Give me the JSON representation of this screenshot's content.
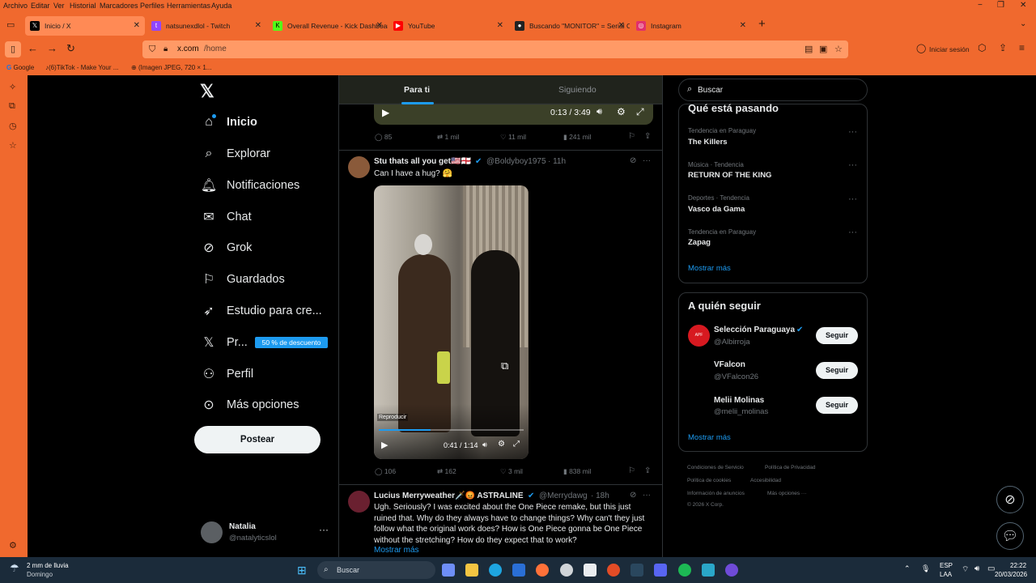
{
  "menubar": {
    "items": [
      "Archivo",
      "Editar",
      "Ver",
      "Historial",
      "Marcadores",
      "Perfiles",
      "Herramientas",
      "Ayuda"
    ]
  },
  "tabs": [
    {
      "label": "Inicio / X",
      "icon": "x-logo-icon",
      "color": "#000000",
      "active": true
    },
    {
      "label": "natsunexdlol - Twitch",
      "icon": "twitch-icon",
      "color": "#9146ff"
    },
    {
      "label": "Overall Revenue - Kick Dashboard",
      "icon": "kick-icon",
      "color": "#53fc18"
    },
    {
      "label": "YouTube",
      "icon": "youtube-icon",
      "color": "#ff0000"
    },
    {
      "label": "Buscando \"MONITOR\" = Serial C",
      "icon": "serial-icon",
      "color": "#222222"
    },
    {
      "label": "Instagram",
      "icon": "instagram-icon",
      "color": "#e1306c"
    }
  ],
  "url": {
    "domain": "x.com",
    "path": "/home"
  },
  "signin": "Iniciar sesión",
  "bookmarks": [
    "Google",
    "(6)TikTok - Make Your ...",
    "(Imagen JPEG, 720 × 1..."
  ],
  "leftnav": {
    "items": [
      {
        "label": "Inicio",
        "icon": "home-icon"
      },
      {
        "label": "Explorar",
        "icon": "search-icon"
      },
      {
        "label": "Notificaciones",
        "icon": "bell-icon"
      },
      {
        "label": "Chat",
        "icon": "mail-icon"
      },
      {
        "label": "Grok",
        "icon": "grok-icon"
      },
      {
        "label": "Guardados",
        "icon": "bookmark-icon"
      },
      {
        "label": "Estudio para cre...",
        "icon": "rocket-icon"
      },
      {
        "label": "Pr...",
        "icon": "x-premium-icon"
      },
      {
        "label": "Perfil",
        "icon": "person-icon"
      },
      {
        "label": "Más opciones",
        "icon": "more-circle-icon"
      }
    ],
    "promo": "50 % de descuento",
    "post": "Postear",
    "user": {
      "name": "Natalia",
      "handle": "@natalyticslol"
    }
  },
  "feed": {
    "tabs": [
      "Para ti",
      "Siguiendo"
    ],
    "top_video": {
      "time": "0:13 / 3:49"
    },
    "top_actions": {
      "replies": "85",
      "reposts": "1 mil",
      "likes": "11 mil",
      "views": "241 mil"
    },
    "tweet1": {
      "name": "Stu thats all you get🇺🇸🏴󠁧󠁢󠁥󠁮󠁧󠁿",
      "handle": "@Boldyboy1975",
      "time": "· 11h",
      "text": "Can I have a hug? 🤗",
      "video": {
        "label": "Reproducir",
        "time": "0:41 / 1:14"
      },
      "actions": {
        "replies": "106",
        "reposts": "162",
        "likes": "3 mil",
        "views": "838 mil"
      }
    },
    "tweet2": {
      "name": "Lucius Merryweather🗡️😡 ASTRALINE",
      "handle": "@Merrydawg",
      "time": "· 18h",
      "text": "Ugh. Seriously? I was excited about the One Piece remake, but this just ruined that. Why do they always have to change things? Why can't they just follow what the original work does? How is One Piece gonna be One Piece without the stretching? How do they expect that to work?",
      "more": "Mostrar más"
    }
  },
  "right": {
    "search_placeholder": "Buscar",
    "trends_title": "Qué está pasando",
    "trends": [
      {
        "sub": "Tendencia en Paraguay",
        "name": "The Killers"
      },
      {
        "sub": "Música · Tendencia",
        "name": "RETURN OF THE KING"
      },
      {
        "sub": "Deportes · Tendencia",
        "name": "Vasco da Gama"
      },
      {
        "sub": "Tendencia en Paraguay",
        "name": "Zapag"
      }
    ],
    "show_more": "Mostrar más",
    "follow_title": "A quién seguir",
    "follow": [
      {
        "name": "Selección Paraguaya",
        "handle": "@Albirroja",
        "verified": true
      },
      {
        "name": "VFalcon",
        "handle": "@VFalcon26"
      },
      {
        "name": "Melii Molinas",
        "handle": "@melii_molinas"
      }
    ],
    "follow_btn": "Seguir",
    "footer": [
      "Condiciones de Servicio",
      "Política de Privacidad",
      "Política de cookies",
      "Accesibilidad",
      "Información de anuncios",
      "Más opciones ···",
      "© 2026 X Corp."
    ]
  },
  "taskbar": {
    "weather": "2 mm de lluvia",
    "weather_sub": "Domingo",
    "search": "Buscar",
    "lang": "ESP",
    "lang_sub": "LAA",
    "time": "22:22",
    "date": "20/03/2026"
  },
  "colors": {
    "accent": "#1d9bf0",
    "chrome": "#f0692e"
  }
}
